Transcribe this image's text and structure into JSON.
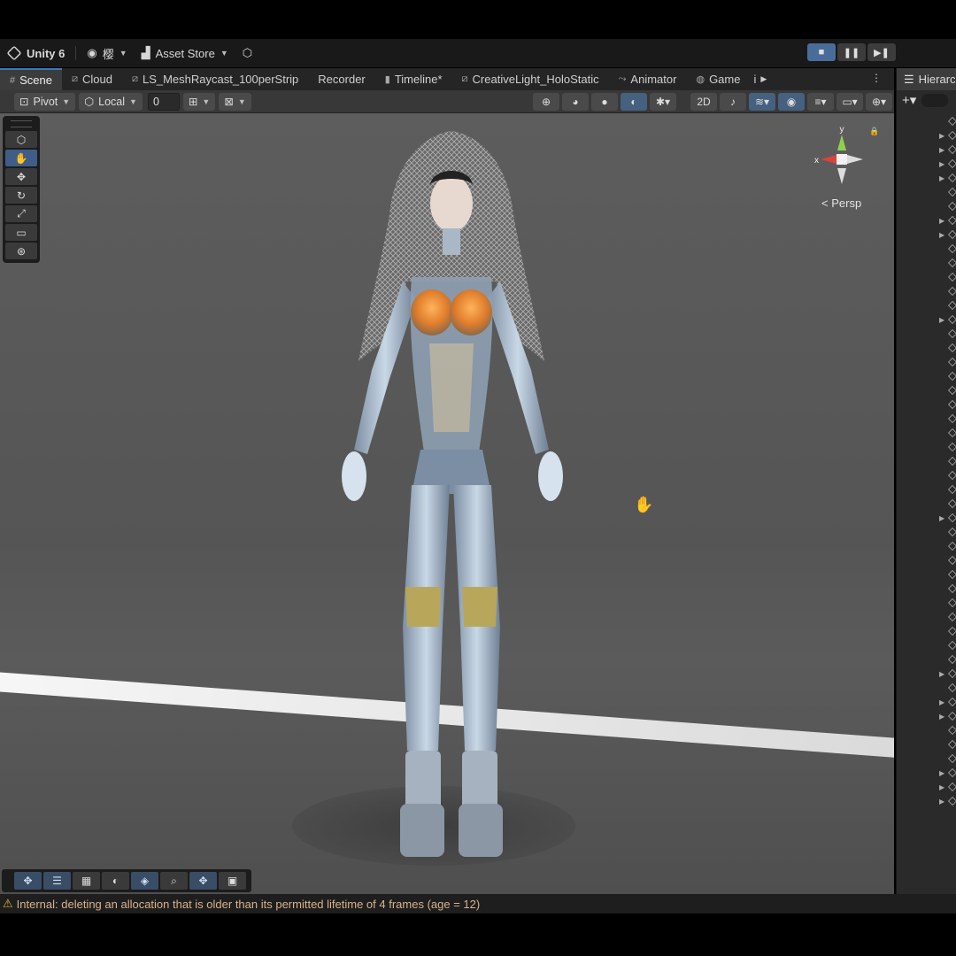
{
  "topbar": {
    "app_title": "Unity 6",
    "account_label": "樱",
    "asset_store_label": "Asset Store",
    "play_buttons": [
      "■",
      "❚❚",
      "▶❚"
    ]
  },
  "tabs": [
    {
      "label": "Scene",
      "icon": "grid-icon",
      "active": true
    },
    {
      "label": "Cloud",
      "icon": "shader-icon",
      "active": false
    },
    {
      "label": "LS_MeshRaycast_100perStrip",
      "icon": "shader-icon",
      "active": false
    },
    {
      "label": "Recorder",
      "icon": "",
      "active": false
    },
    {
      "label": "Timeline*",
      "icon": "timeline-icon",
      "active": false
    },
    {
      "label": "CreativeLight_HoloStatic",
      "icon": "shader-icon",
      "active": false
    },
    {
      "label": "Animator",
      "icon": "animator-icon",
      "active": false
    },
    {
      "label": "Game",
      "icon": "game-icon",
      "active": false
    },
    {
      "label": "i",
      "icon": "",
      "active": false
    }
  ],
  "scene_toolbar": {
    "pivot_label": "Pivot",
    "local_label": "Local",
    "snap_value": "0"
  },
  "viewport": {
    "projection_label": "Persp",
    "gizmo_x": "x",
    "gizmo_y": "y"
  },
  "hierarchy": {
    "tab_label": "Hierarc"
  },
  "status": {
    "message": "Internal: deleting an allocation that is older than its permitted lifetime of 4 frames (age = 12)"
  },
  "colors": {
    "accent": "#3a79bb",
    "warning": "#e8b43b",
    "gizmo_x": "#d9443a",
    "gizmo_y": "#8fd14f"
  }
}
